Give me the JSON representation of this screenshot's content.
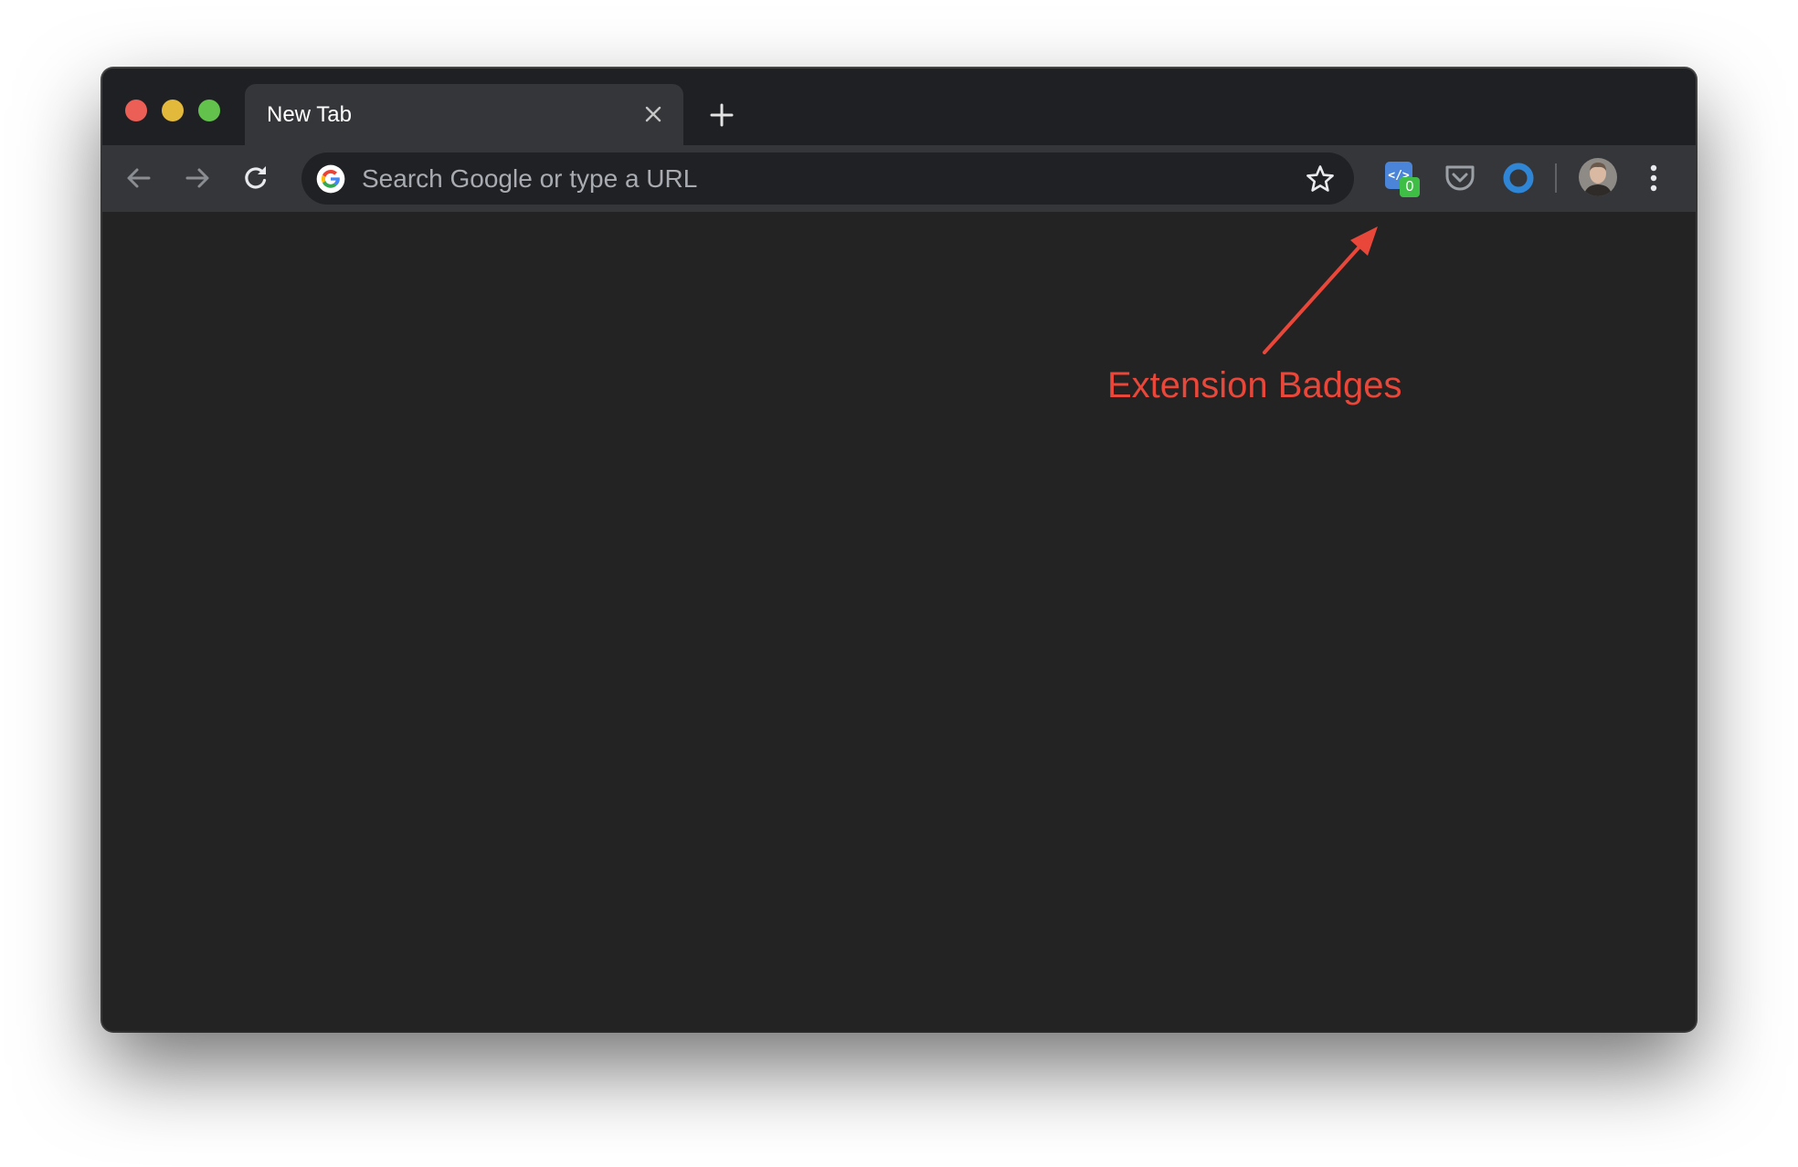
{
  "tab": {
    "title": "New Tab",
    "close_icon": "close-icon",
    "new_tab_icon": "plus-icon"
  },
  "toolbar": {
    "back_icon": "arrow-left-icon",
    "forward_icon": "arrow-right-icon",
    "reload_icon": "reload-icon",
    "omnibox": {
      "placeholder": "Search Google or type a URL",
      "value": "",
      "search_engine_icon": "google-icon",
      "bookmark_icon": "star-icon"
    },
    "extensions": [
      {
        "name": "devtools-extension",
        "icon": "code-icon",
        "badge": "0",
        "badge_color": "#3fbe46",
        "color": "#4a85d9"
      },
      {
        "name": "pocket-extension",
        "icon": "pocket-icon"
      },
      {
        "name": "ring-extension",
        "icon": "ring-icon",
        "color": "#2f86d7"
      }
    ],
    "avatar_icon": "avatar-icon",
    "menu_icon": "kebab-menu-icon"
  },
  "annotation": {
    "label": "Extension Badges",
    "color": "#e8473a"
  },
  "window": {
    "traffic_lights": [
      "#ec5f57",
      "#e3b93b",
      "#63c24c"
    ]
  }
}
